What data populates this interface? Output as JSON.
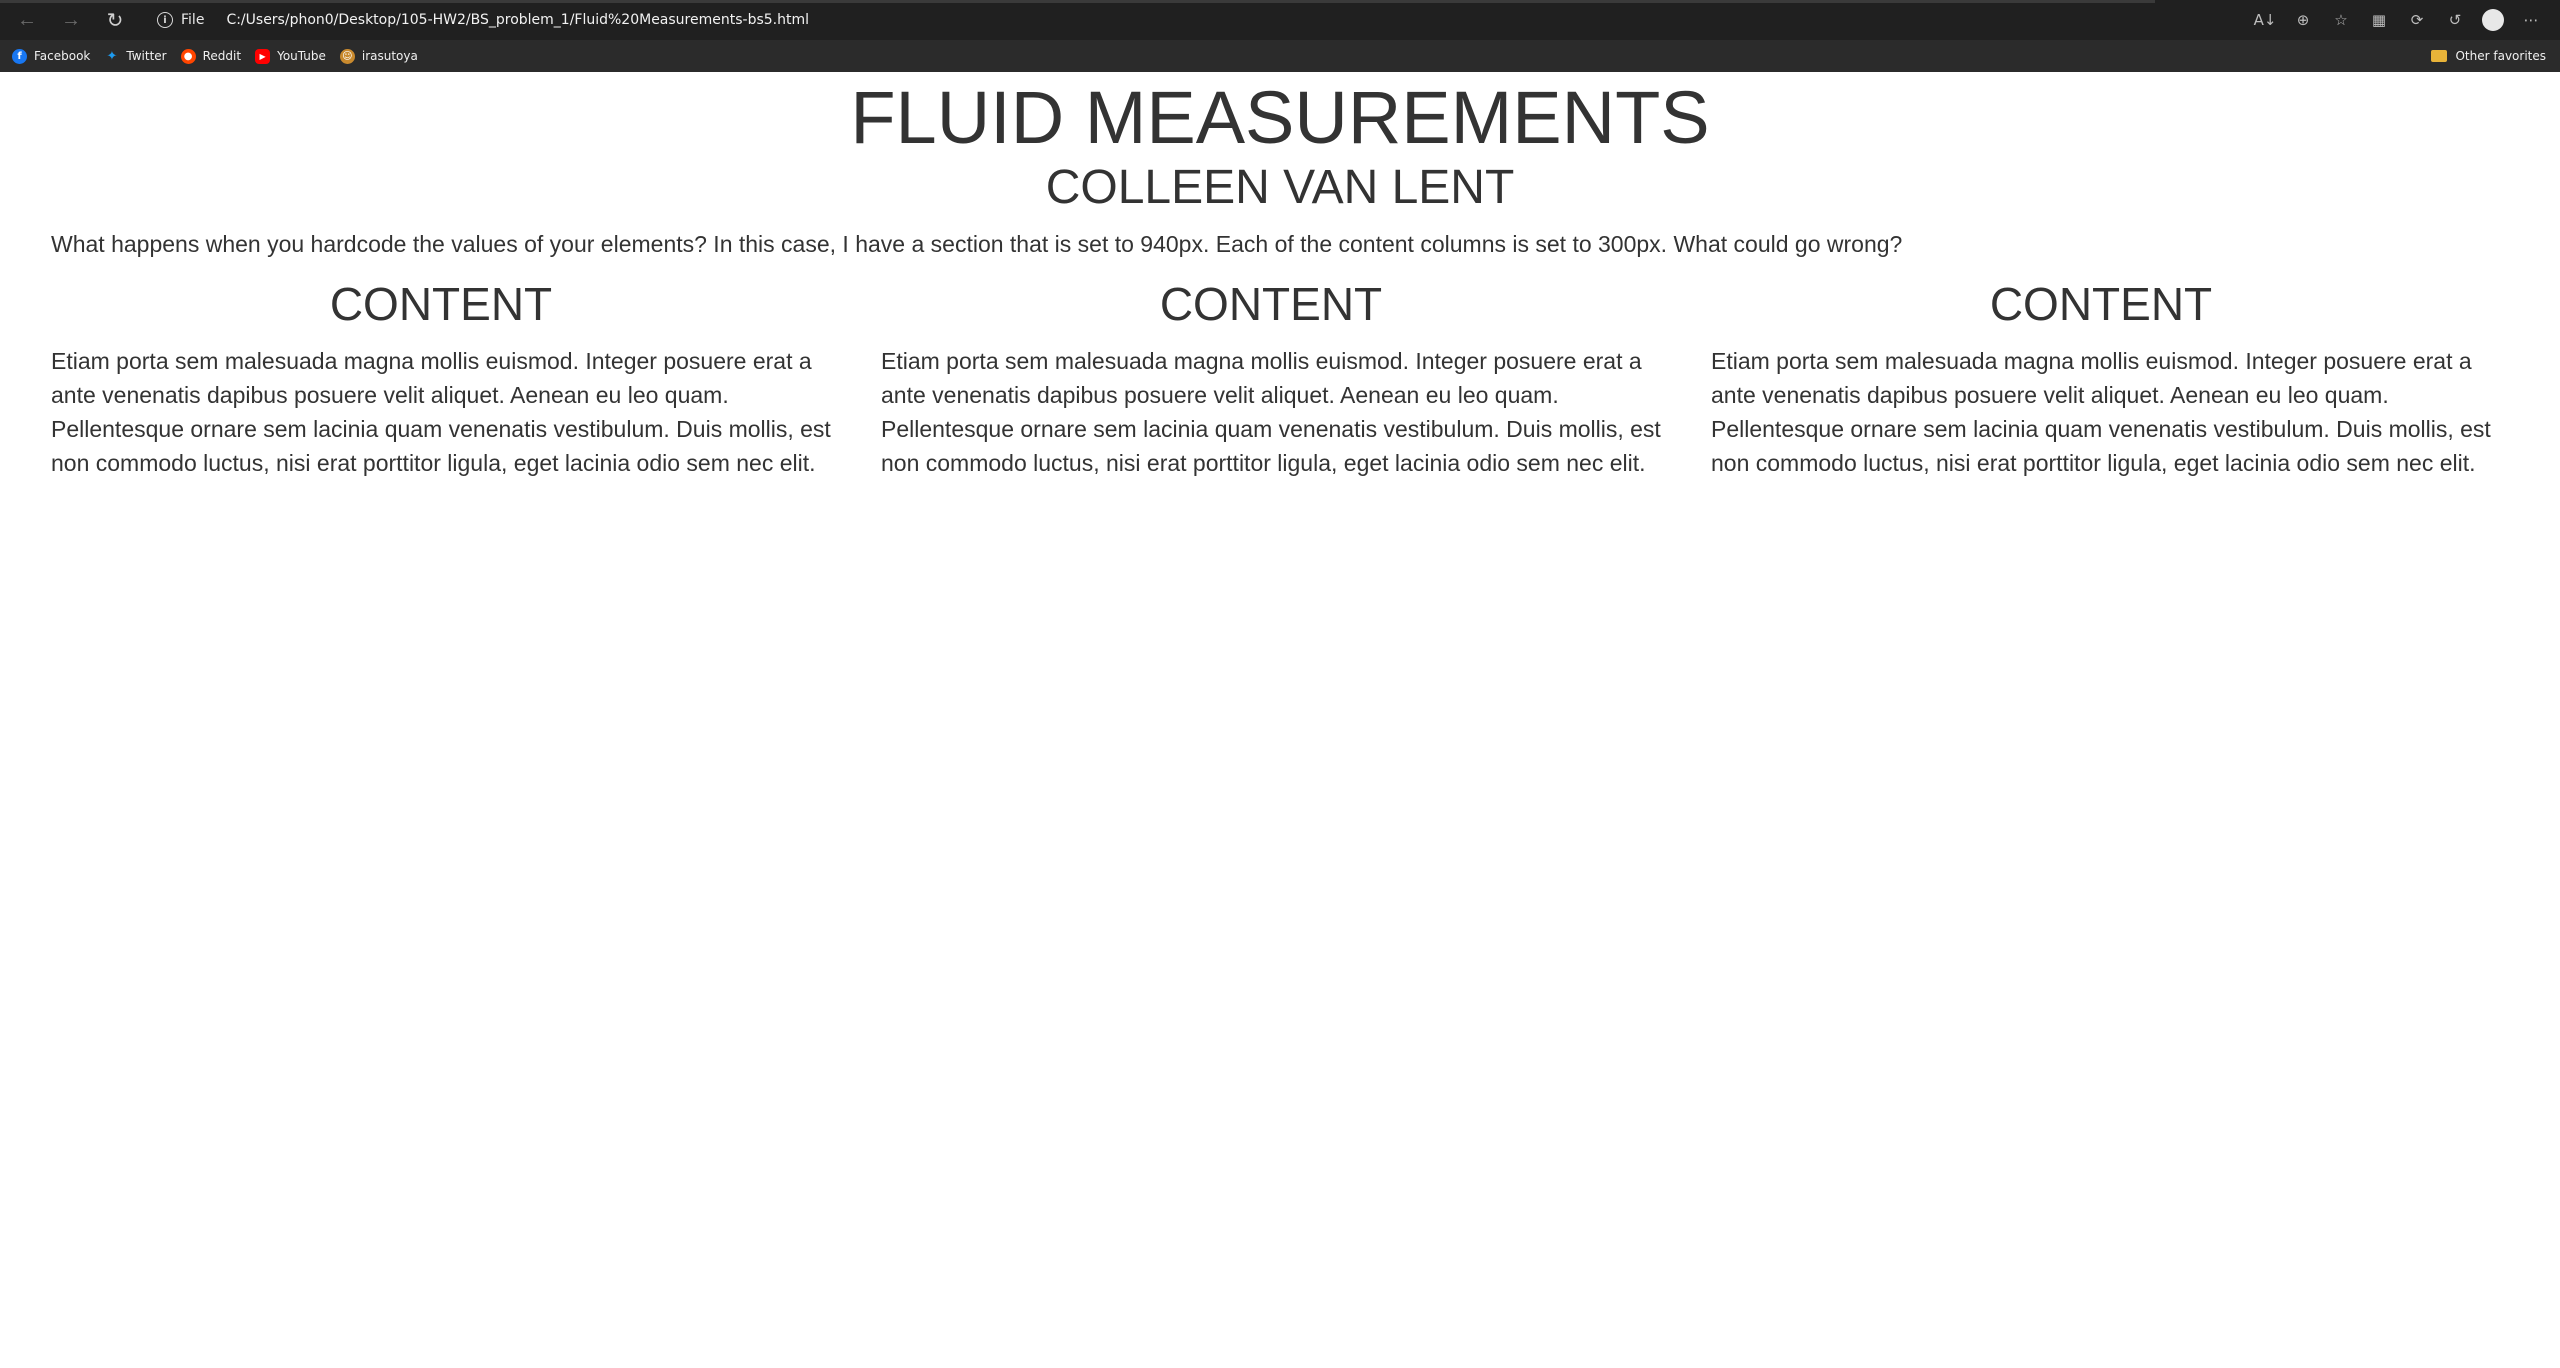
{
  "browser": {
    "address": {
      "scheme_label": "File",
      "url": "C:/Users/phon0/Desktop/105-HW2/BS_problem_1/Fluid%20Measurements-bs5.html"
    },
    "bookmarks": [
      {
        "label": "Facebook",
        "icon": "facebook-icon",
        "color": "#1877f2"
      },
      {
        "label": "Twitter",
        "icon": "twitter-icon",
        "color": "#1d9bf0"
      },
      {
        "label": "Reddit",
        "icon": "reddit-icon",
        "color": "#ff4500"
      },
      {
        "label": "YouTube",
        "icon": "youtube-icon",
        "color": "#ff0000"
      },
      {
        "label": "irasutoya",
        "icon": "irasutoya-icon",
        "color": "#c98a2e"
      }
    ],
    "other_favorites": "Other favorites"
  },
  "page": {
    "title": "FLUID MEASUREMENTS",
    "subtitle": "COLLEEN VAN LENT",
    "intro": "What happens when you hardcode the values of your elements? In this case, I have a section that is set to 940px. Each of the content columns is set to 300px. What could go wrong?",
    "columns": [
      {
        "heading": "CONTENT",
        "text": "Etiam porta sem malesuada magna mollis euismod. Integer posuere erat a ante venenatis dapibus posuere velit aliquet. Aenean eu leo quam. Pellentesque ornare sem lacinia quam venenatis vestibulum. Duis mollis, est non commodo luctus, nisi erat porttitor ligula, eget lacinia odio sem nec elit."
      },
      {
        "heading": "CONTENT",
        "text": "Etiam porta sem malesuada magna mollis euismod. Integer posuere erat a ante venenatis dapibus posuere velit aliquet. Aenean eu leo quam. Pellentesque ornare sem lacinia quam venenatis vestibulum. Duis mollis, est non commodo luctus, nisi erat porttitor ligula, eget lacinia odio sem nec elit."
      },
      {
        "heading": "CONTENT",
        "text": "Etiam porta sem malesuada magna mollis euismod. Integer posuere erat a ante venenatis dapibus posuere velit aliquet. Aenean eu leo quam. Pellentesque ornare sem lacinia quam venenatis vestibulum. Duis mollis, est non commodo luctus, nisi erat porttitor ligula, eget lacinia odio sem nec elit."
      }
    ]
  },
  "colors": {
    "text": "#333333",
    "chrome": "#202020",
    "bookmarks_bar": "#2b2b2b"
  }
}
